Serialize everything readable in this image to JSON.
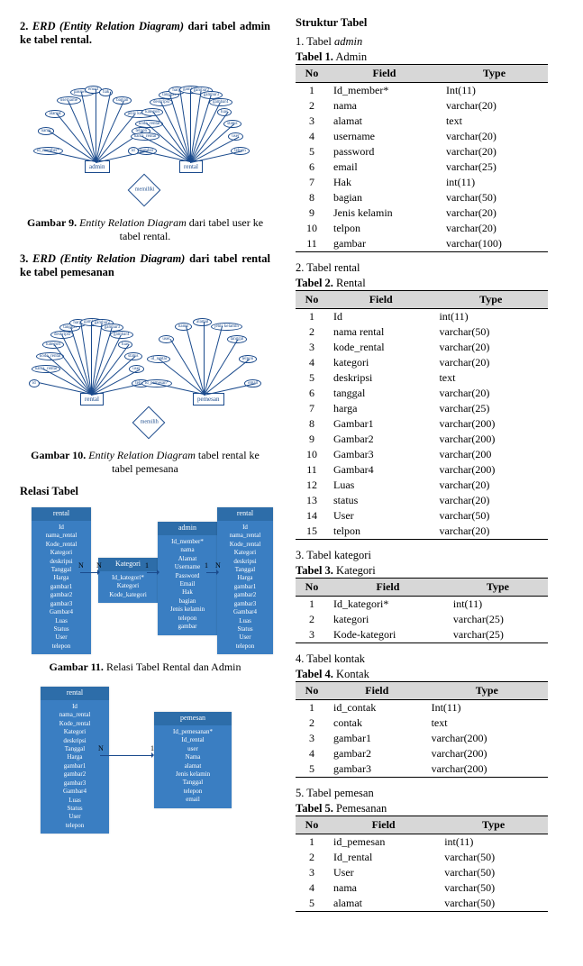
{
  "left": {
    "sec2": {
      "num": "2.",
      "title_italic": "ERD (Entity Relation Diagram)",
      "title_rest": " dari tabel admin ke tabel rental."
    },
    "fig9": {
      "b": "Gambar 9.",
      "rest_italic": " Entity Relation Diagram",
      "rest": " dari tabel user ke tabel rental."
    },
    "sec3": {
      "num": "3.",
      "title_italic": "ERD (Entity Relation Diagram)",
      "title_rest": " dari tabel rental ke tabel pemesanan"
    },
    "fig10": {
      "b": "Gambar 10.",
      "rest_italic": " Entity Relation Diagram",
      "rest": " tabel rental ke tabel pemesana"
    },
    "relasi_heading": "Relasi Tabel",
    "fig11": {
      "b": "Gambar 11.",
      "rest": " Relasi Tabel Rental dan Admin"
    },
    "erd1": {
      "e1": "admin",
      "e2": "rental",
      "rel": "memiliki",
      "a1": [
        "id_member*",
        "nama",
        "alamat",
        "username",
        "password",
        "email",
        "hak",
        "bagian",
        "jenis kelamin",
        "telpon",
        "gambar"
      ],
      "a2": [
        "id",
        "nama_rental",
        "kode_rental",
        "kategori",
        "deskripsi",
        "tanggal",
        "harga",
        "gambar1",
        "gambar2",
        "gambar3",
        "gambar4",
        "luas",
        "status",
        "user",
        "telpon"
      ]
    },
    "erd2": {
      "e1": "rental",
      "e2": "pemesan",
      "rel": "memilih",
      "a1": [
        "id",
        "nama_rental",
        "kode_rental",
        "kategori",
        "deskripsi",
        "tanggal",
        "harga",
        "gambar1",
        "gambar2",
        "gambar3",
        "gambar4",
        "luas",
        "status",
        "user",
        "telpon"
      ],
      "a2": [
        "id_pemesan*",
        "id_rental",
        "user",
        "nama",
        "alamat",
        "jenis kelamin",
        "tanggal",
        "telpon",
        "email"
      ]
    },
    "rel1": {
      "box_rental_hdr": "rental",
      "box_rental_fields": [
        "Id",
        "nama_rental",
        "Kode_rental",
        "Kategori",
        "deskripsi",
        "Tanggal",
        "Harga",
        "gambar1",
        "gambar2",
        "gambar3",
        "Gambar4",
        "Luas",
        "Status",
        "User",
        "telepon"
      ],
      "box_kategori_hdr": "Kategori",
      "box_kategori_fields": [
        "Id_kategori*",
        "Kategori",
        "Kode_kategori"
      ],
      "box_admin_hdr": "admin",
      "box_admin_fields": [
        "Id_member*",
        "nama",
        "Alamat",
        "Username",
        "Password",
        "Email",
        "Hak",
        "bagian",
        "Jenis kelamin",
        "telepon",
        "gambar"
      ],
      "box_rental2_hdr": "rental",
      "box_rental2_fields": [
        "Id",
        "nama_rental",
        "Kode_rental",
        "Kategori",
        "deskripsi",
        "Tanggal",
        "Harga",
        "gambar1",
        "gambar2",
        "gambar3",
        "Gambar4",
        "Luas",
        "Status",
        "User",
        "telepon"
      ]
    },
    "rel2": {
      "box_rental_hdr": "rental",
      "box_rental_fields": [
        "Id",
        "nama_rental",
        "Kode_rental",
        "Kategori",
        "deskripsi",
        "Tanggal",
        "Harga",
        "gambar1",
        "gambar2",
        "gambar3",
        "Gambar4",
        "Luas",
        "Status",
        "User",
        "telepon"
      ],
      "box_pemesan_hdr": "pemesan",
      "box_pemesan_fields": [
        "Id_pemesanan*",
        "Id_rental",
        "user",
        "Nama",
        "alamat",
        "Jenis kelamin",
        "Tanggal",
        "telepon",
        "email"
      ]
    }
  },
  "right": {
    "struktur_heading": "Struktur Tabel",
    "tables": [
      {
        "list_label": "1.  Tabel ",
        "list_italic": "admin",
        "title_b": "Tabel 1.",
        "title_rest": " Admin",
        "headers": [
          "No",
          "Field",
          "Type"
        ],
        "rows": [
          [
            "1",
            "Id_member*",
            "Int(11)"
          ],
          [
            "2",
            "nama",
            "varchar(20)"
          ],
          [
            "3",
            "alamat",
            "text"
          ],
          [
            "4",
            "username",
            "varchar(20)"
          ],
          [
            "5",
            "password",
            "varchar(20)"
          ],
          [
            "6",
            "email",
            "varchar(25)"
          ],
          [
            "7",
            "Hak",
            "int(11)"
          ],
          [
            "8",
            "bagian",
            "varchar(50)"
          ],
          [
            "9",
            "Jenis kelamin",
            "varchar(20)"
          ],
          [
            "10",
            "telpon",
            "varchar(20)"
          ],
          [
            "11",
            "gambar",
            "varchar(100)"
          ]
        ]
      },
      {
        "list_label": "2.  Tabel rental",
        "list_italic": "",
        "title_b": "Tabel 2.",
        "title_rest": " Rental",
        "headers": [
          "No",
          "Field",
          "Type"
        ],
        "rows": [
          [
            "1",
            "Id",
            "int(11)"
          ],
          [
            "2",
            "nama rental",
            "varchar(50)"
          ],
          [
            "3",
            "kode_rental",
            "varchar(20)"
          ],
          [
            "4",
            "kategori",
            "varchar(20)"
          ],
          [
            "5",
            "deskripsi",
            "text"
          ],
          [
            "6",
            "tanggal",
            "varchar(20)"
          ],
          [
            "7",
            "harga",
            "varchar(25)"
          ],
          [
            "8",
            "Gambar1",
            "varchar(200)"
          ],
          [
            "9",
            "Gambar2",
            "varchar(200)"
          ],
          [
            "10",
            "Gambar3",
            "varchar(200"
          ],
          [
            "11",
            "Gambar4",
            "varchar(200)"
          ],
          [
            "12",
            "Luas",
            "varchar(20)"
          ],
          [
            "13",
            "status",
            "varchar(20)"
          ],
          [
            "14",
            "User",
            "varchar(50)"
          ],
          [
            "15",
            "telpon",
            "varchar(20)"
          ]
        ]
      },
      {
        "list_label": "3.  Tabel kategori",
        "list_italic": "",
        "title_b": "Tabel 3.",
        "title_rest": " Kategori",
        "headers": [
          "No",
          "Field",
          "Type"
        ],
        "rows": [
          [
            "1",
            "Id_kategori*",
            "int(11)"
          ],
          [
            "2",
            "kategori",
            "varchar(25)"
          ],
          [
            "3",
            "Kode-kategori",
            "varchar(25)"
          ]
        ]
      },
      {
        "list_label": "4.  Tabel kontak",
        "list_italic": "",
        "title_b": "Tabel 4.",
        "title_rest": " Kontak",
        "headers": [
          "No",
          "Field",
          "Type"
        ],
        "rows": [
          [
            "1",
            "id_contak",
            "Int(11)"
          ],
          [
            "2",
            "contak",
            "text"
          ],
          [
            "3",
            "gambar1",
            "varchar(200)"
          ],
          [
            "4",
            "gambar2",
            "varchar(200)"
          ],
          [
            "5",
            "gambar3",
            "varchar(200)"
          ]
        ]
      },
      {
        "list_label": "5.  Tabel pemesan",
        "list_italic": "",
        "title_b": "Tabel 5.",
        "title_rest": " Pemesanan",
        "headers": [
          "No",
          "Field",
          "Type"
        ],
        "rows": [
          [
            "1",
            "id_pemesan",
            "int(11)"
          ],
          [
            "2",
            "Id_rental",
            "varchar(50)"
          ],
          [
            "3",
            "User",
            "varchar(50)"
          ],
          [
            "4",
            "nama",
            "varchar(50)"
          ],
          [
            "5",
            "alamat",
            "varchar(50)"
          ]
        ]
      }
    ]
  },
  "glyphs": {
    "N": "N",
    "one": "1"
  }
}
